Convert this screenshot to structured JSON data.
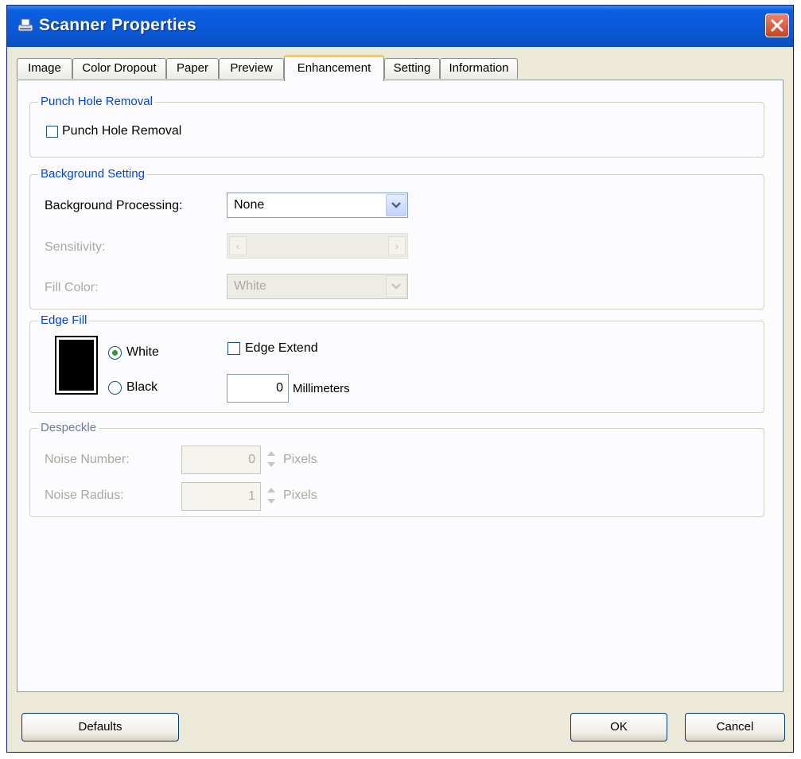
{
  "window": {
    "title": "Scanner Properties",
    "title_icon": "scanner-icon",
    "close_icon": "close-icon"
  },
  "tabs": [
    {
      "label": "Image",
      "active": false
    },
    {
      "label": "Color Dropout",
      "active": false
    },
    {
      "label": "Paper",
      "active": false
    },
    {
      "label": "Preview",
      "active": false
    },
    {
      "label": "Enhancement",
      "active": true
    },
    {
      "label": "Setting",
      "active": false
    },
    {
      "label": "Information",
      "active": false
    }
  ],
  "punch_hole": {
    "legend": "Punch Hole Removal",
    "checkbox_label": "Punch Hole Removal",
    "checked": false
  },
  "background": {
    "legend": "Background Setting",
    "processing_label": "Background Processing:",
    "processing_value": "None",
    "sensitivity_label": "Sensitivity:",
    "fill_color_label": "Fill Color:",
    "fill_color_value": "White"
  },
  "edge_fill": {
    "legend": "Edge Fill",
    "white_label": "White",
    "black_label": "Black",
    "selected": "White",
    "edge_extend_label": "Edge Extend",
    "edge_extend_checked": false,
    "millimeters_value": "0",
    "millimeters_label": "Millimeters"
  },
  "despeckle": {
    "legend": "Despeckle",
    "noise_number_label": "Noise Number:",
    "noise_number_value": "0",
    "noise_radius_label": "Noise Radius:",
    "noise_radius_value": "1",
    "pixels_label": "Pixels"
  },
  "buttons": {
    "defaults": "Defaults",
    "ok": "OK",
    "cancel": "Cancel"
  }
}
